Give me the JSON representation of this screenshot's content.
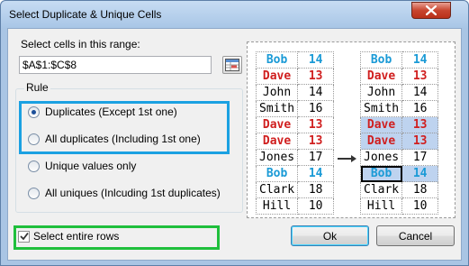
{
  "window": {
    "title": "Select Duplicate & Unique Cells"
  },
  "range": {
    "label": "Select cells in this range:",
    "value": "$A$1:$C$8"
  },
  "rule": {
    "legend": "Rule",
    "options": [
      {
        "label": "Duplicates (Except 1st one)",
        "selected": true
      },
      {
        "label": "All duplicates (Including 1st one)",
        "selected": false
      },
      {
        "label": "Unique values only",
        "selected": false
      },
      {
        "label": "All uniques (Inlcuding 1st duplicates)",
        "selected": false
      }
    ]
  },
  "select_entire_rows": {
    "label": "Select entire rows",
    "checked": true
  },
  "buttons": {
    "ok": "Ok",
    "cancel": "Cancel"
  },
  "preview": {
    "before": [
      {
        "name": "Bob",
        "value": "14",
        "style": "blue"
      },
      {
        "name": "Dave",
        "value": "13",
        "style": "red"
      },
      {
        "name": "John",
        "value": "14",
        "style": "black"
      },
      {
        "name": "Smith",
        "value": "16",
        "style": "black"
      },
      {
        "name": "Dave",
        "value": "13",
        "style": "red"
      },
      {
        "name": "Dave",
        "value": "13",
        "style": "red"
      },
      {
        "name": "Jones",
        "value": "17",
        "style": "black"
      },
      {
        "name": "Bob",
        "value": "14",
        "style": "blue"
      },
      {
        "name": "Clark",
        "value": "18",
        "style": "black"
      },
      {
        "name": "Hill",
        "value": "10",
        "style": "black"
      }
    ],
    "after_highlighted_rows": [
      4,
      5,
      7
    ],
    "after_active_row": 7
  },
  "colors": {
    "accent_blue": "#1ba1e2",
    "accent_green": "#1fbf3c",
    "dup_blue": "#1a9ad6",
    "dup_red": "#d01f1f",
    "highlight": "#bed3ef"
  }
}
